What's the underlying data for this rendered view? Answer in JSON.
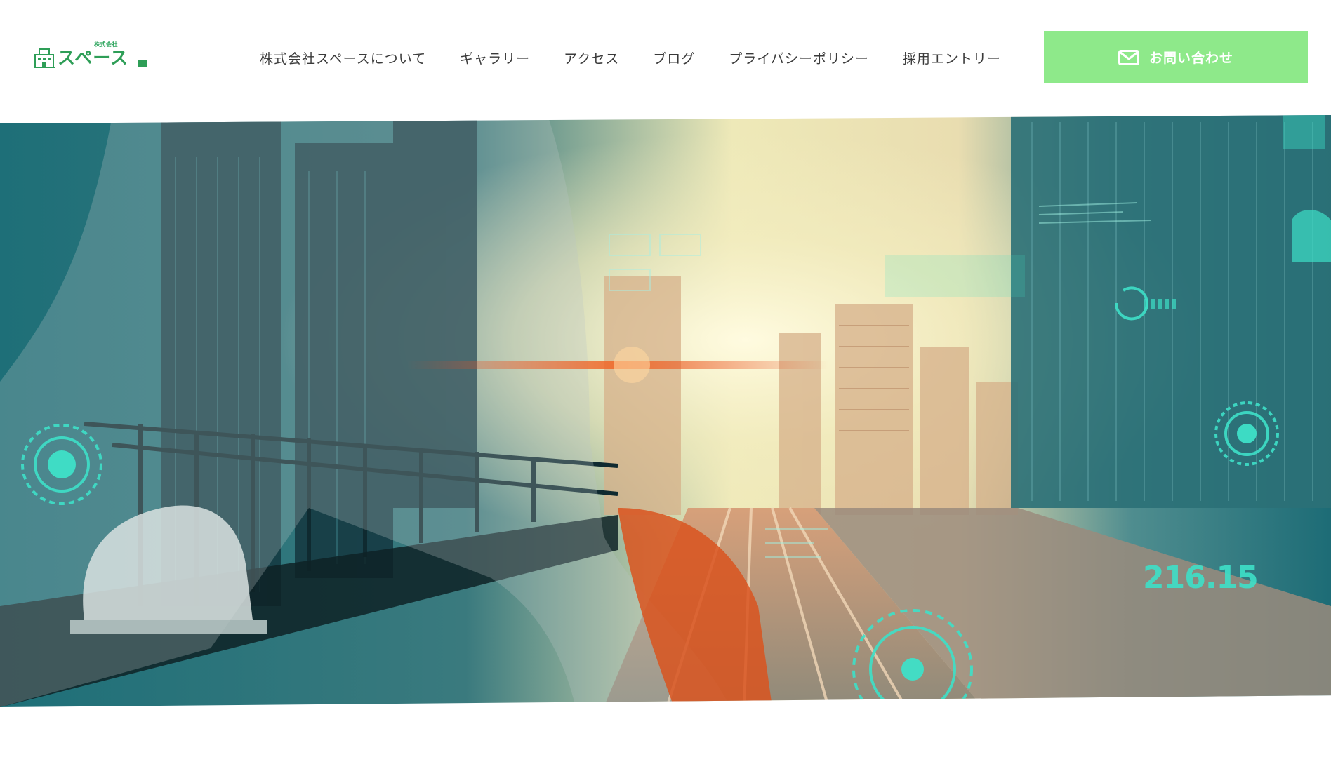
{
  "header": {
    "logo": {
      "company_type": "株式会社",
      "name": "スペース",
      "icon": "building-icon"
    },
    "nav": {
      "items": [
        {
          "label": "株式会社スペースについて"
        },
        {
          "label": "ギャラリー"
        },
        {
          "label": "アクセス"
        },
        {
          "label": "ブログ"
        },
        {
          "label": "プライバシーポリシー"
        },
        {
          "label": "採用エントリー"
        }
      ]
    },
    "contact": {
      "label": "お問い合わせ",
      "icon": "mail-icon",
      "color": "#8ee98a"
    }
  },
  "hero": {
    "overlay_value": "216.15",
    "colors": {
      "teal": "#1f7f88",
      "glow": "#f3f2c4",
      "accent": "#3ee0c8",
      "orange": "#e0572a"
    }
  }
}
